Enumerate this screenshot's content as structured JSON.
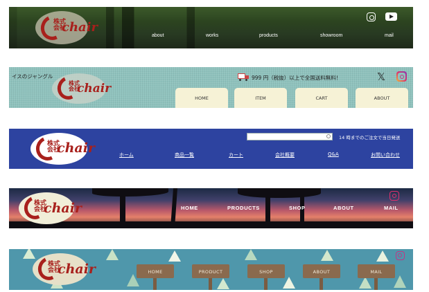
{
  "banner1": {
    "logo": {
      "kanji": "株式会社",
      "word": "chair"
    },
    "nav": [
      "about",
      "works",
      "products",
      "showroom",
      "mail"
    ],
    "icons": [
      "instagram-icon",
      "youtube-icon"
    ]
  },
  "banner2": {
    "tagline": "イスのジャングル",
    "logo": {
      "kanji": "株式会社",
      "word": "chair"
    },
    "shipping": "999 円（税抜）以上で全国送料無料！",
    "social": {
      "x": "𝕏"
    },
    "tabs": [
      "HOME",
      "ITEM",
      "CART",
      "ABOUT"
    ]
  },
  "banner3": {
    "logo": {
      "kanji": "株式会社",
      "word": "chair"
    },
    "search": {
      "value": "",
      "placeholder": ""
    },
    "sameday": "14 時までのご注文で当日発送",
    "nav": [
      "ホーム",
      "商品一覧",
      "カート",
      "会社概要",
      "Q&A",
      "お問い合わせ"
    ]
  },
  "banner4": {
    "logo": {
      "kanji": "株式会社",
      "word": "chair"
    },
    "nav": [
      "HOME",
      "PRODUCTS",
      "SHOP",
      "ABOUT",
      "MAIL"
    ]
  },
  "banner5": {
    "logo": {
      "kanji": "株式会社",
      "word": "chair"
    },
    "signs": [
      "HOME",
      "PRODUCT",
      "SHOP",
      "ABOUT",
      "MAIL"
    ]
  },
  "colors": {
    "logo_red": "#a8201c",
    "teal": "#8fc2bd",
    "blue": "#2d43a0",
    "tab_cream": "#f6f2d6",
    "sign_brown": "#8a6a4e",
    "triangle_blue": "#4f97ab"
  }
}
